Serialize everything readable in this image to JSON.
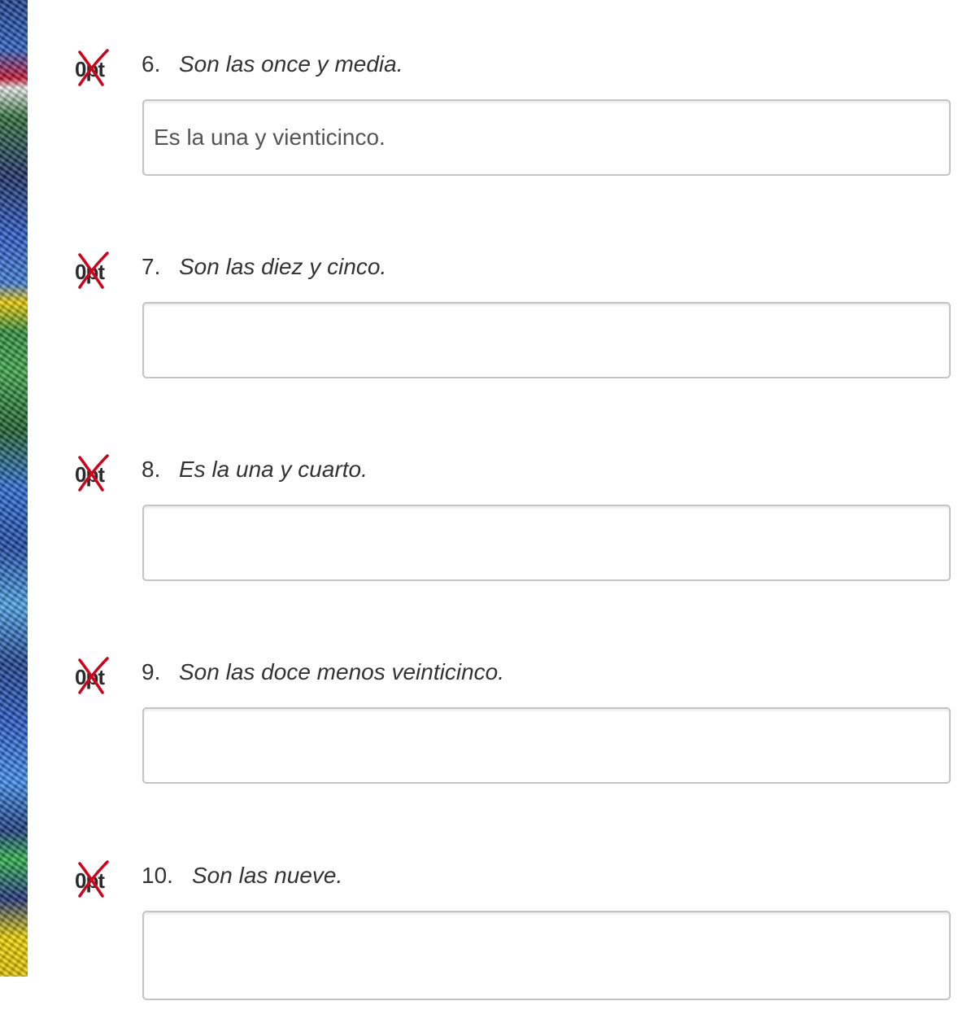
{
  "questions": [
    {
      "number": "6.",
      "prompt": "Son las once y media.",
      "score": "0pt",
      "answer": "Es la una y vienticinco."
    },
    {
      "number": "7.",
      "prompt": "Son las diez y cinco.",
      "score": "0pt",
      "answer": ""
    },
    {
      "number": "8.",
      "prompt": "Es la una y cuarto.",
      "score": "0pt",
      "answer": ""
    },
    {
      "number": "9.",
      "prompt": "Son las doce menos veinticinco.",
      "score": "0pt",
      "answer": ""
    },
    {
      "number": "10.",
      "prompt": "Son las nueve.",
      "score": "0pt",
      "answer": ""
    }
  ],
  "incorrect_mark_icon": "red-x-icon",
  "colors": {
    "incorrect_mark": "#d0021b",
    "text": "#333333",
    "input_border": "#c4c4c4"
  }
}
